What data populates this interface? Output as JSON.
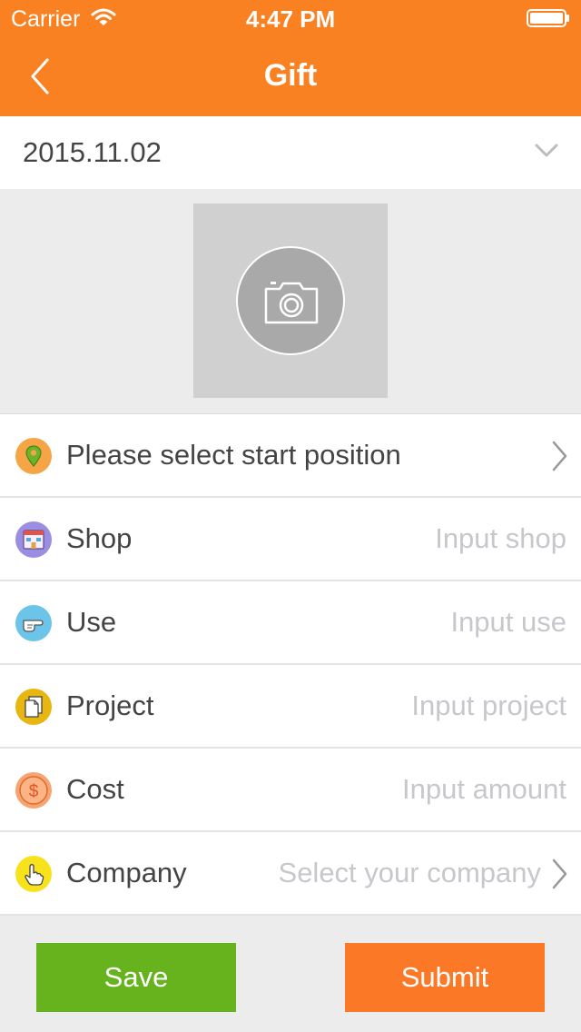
{
  "status_bar": {
    "carrier": "Carrier",
    "time": "4:47 PM",
    "wifi_icon": "wifi-icon",
    "battery_icon": "battery-icon"
  },
  "nav": {
    "title": "Gift",
    "back_icon": "chevron-left-icon"
  },
  "date_picker": {
    "value": "2015.11.02",
    "icon": "chevron-down-icon"
  },
  "photo": {
    "icon": "camera-icon"
  },
  "form": {
    "rows": [
      {
        "key": "position",
        "icon": "location-pin-icon",
        "icon_color": "#f5a545",
        "label": "Please select start position",
        "type": "select"
      },
      {
        "key": "shop",
        "icon": "shop-icon",
        "icon_color": "#9b8de2",
        "label": "Shop",
        "placeholder": "Input shop",
        "type": "input"
      },
      {
        "key": "use",
        "icon": "pointing-hand-icon",
        "icon_color": "#6cc5e8",
        "label": "Use",
        "placeholder": "Input use",
        "type": "input"
      },
      {
        "key": "project",
        "icon": "document-icon",
        "icon_color": "#e8b611",
        "label": "Project",
        "placeholder": "Input project",
        "type": "input"
      },
      {
        "key": "cost",
        "icon": "dollar-icon",
        "icon_color": "#f7a473",
        "label": "Cost",
        "placeholder": "Input amount",
        "type": "input"
      },
      {
        "key": "company",
        "icon": "hand-icon",
        "icon_color": "#f7e21c",
        "label": "Company",
        "value": "Select your company",
        "type": "select"
      }
    ]
  },
  "buttons": {
    "save_label": "Save",
    "submit_label": "Submit"
  },
  "colors": {
    "nav_background": "#f98122",
    "save_button": "#67b31e",
    "submit_button": "#fb7926",
    "placeholder": "#c7c7cc"
  }
}
